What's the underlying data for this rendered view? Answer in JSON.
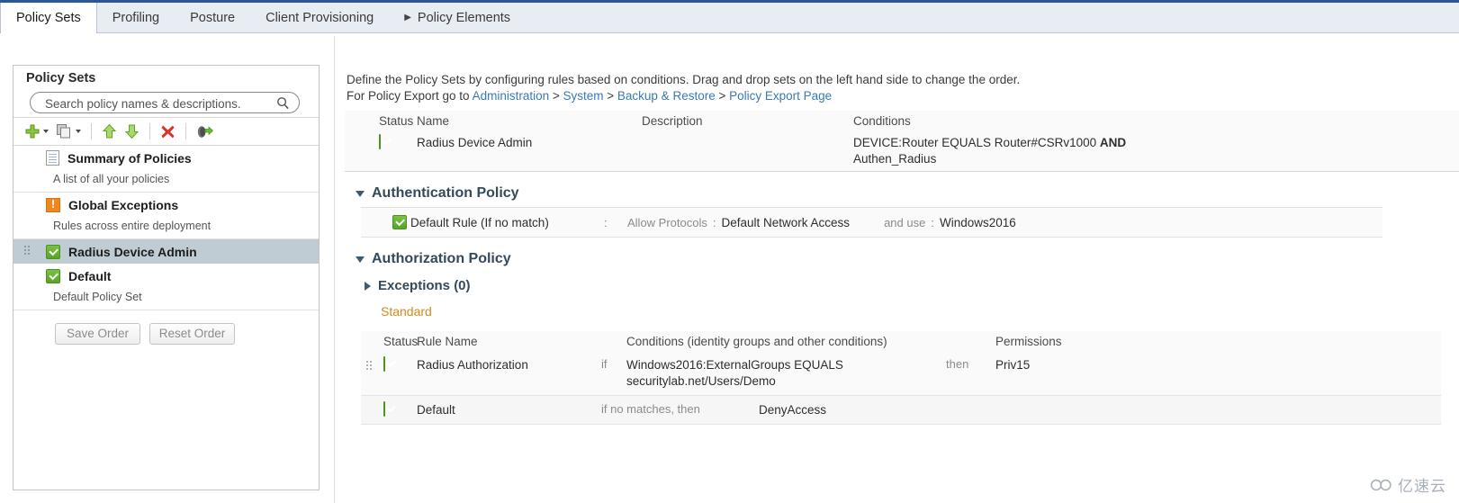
{
  "tabs": [
    {
      "label": "Policy Sets",
      "active": true,
      "arrow": false
    },
    {
      "label": "Profiling",
      "active": false,
      "arrow": false
    },
    {
      "label": "Posture",
      "active": false,
      "arrow": false
    },
    {
      "label": "Client Provisioning",
      "active": false,
      "arrow": false
    },
    {
      "label": "Policy Elements",
      "active": false,
      "arrow": true
    }
  ],
  "sidebar": {
    "title": "Policy Sets",
    "search_placeholder": "Search policy names & descriptions.",
    "search_value": "",
    "toolbar": [
      {
        "name": "add",
        "glyph": "+",
        "dropdown": true
      },
      {
        "name": "duplicate",
        "glyph": "copy",
        "dropdown": true
      },
      {
        "name": "move-up",
        "glyph": "up",
        "dropdown": false
      },
      {
        "name": "move-down",
        "glyph": "down",
        "dropdown": false
      },
      {
        "name": "delete",
        "glyph": "x",
        "dropdown": false
      },
      {
        "name": "export",
        "glyph": "export",
        "dropdown": false
      }
    ],
    "items": [
      {
        "label": "Summary of Policies",
        "sub": "A list of all your policies",
        "icon": "document",
        "selected": false,
        "grip": false
      },
      {
        "label": "Global Exceptions",
        "sub": "Rules across entire deployment",
        "icon": "warning",
        "selected": false,
        "grip": false
      },
      {
        "label": "Radius Device Admin",
        "sub": "",
        "icon": "check",
        "selected": true,
        "grip": true
      },
      {
        "label": "Default",
        "sub": "Default Policy Set",
        "icon": "check",
        "selected": false,
        "grip": false
      }
    ],
    "save_order_label": "Save Order",
    "reset_order_label": "Reset Order"
  },
  "main": {
    "intro_line1": "Define the Policy Sets by configuring rules based on conditions. Drag and drop sets on the left hand side to change the order.",
    "intro_line2_prefix": "For Policy Export go to ",
    "intro_breadcrumb": [
      {
        "text": "Administration",
        "link": true
      },
      {
        "text": " > ",
        "link": false
      },
      {
        "text": "System",
        "link": true
      },
      {
        "text": " > ",
        "link": false
      },
      {
        "text": "Backup & Restore",
        "link": true
      },
      {
        "text": " > ",
        "link": false
      },
      {
        "text": "Policy Export Page",
        "link": true
      }
    ],
    "policyset_table": {
      "headers": [
        "Status",
        "Name",
        "Description",
        "Conditions"
      ],
      "row": {
        "status": "enabled",
        "name": "Radius Device Admin",
        "description": "",
        "conditions_line1_normal": "DEVICE:Router EQUALS Router#CSRv1000 ",
        "conditions_line1_bold": "AND",
        "conditions_line2": "Authen_Radius"
      }
    },
    "authentication_policy": {
      "title": "Authentication Policy",
      "expanded": true,
      "rule": {
        "status": "enabled",
        "name": "Default Rule (If no match)",
        "colon1": ":",
        "allow_protocols_label": "Allow Protocols",
        "colon2": ":",
        "allow_protocols_value": "Default Network Access",
        "and_use_label": "and use",
        "colon3": ":",
        "and_use_value": "Windows2016"
      }
    },
    "authorization_policy": {
      "title": "Authorization Policy",
      "expanded": true,
      "exceptions_label": "Exceptions (0)",
      "exceptions_expanded": false,
      "standard_label": "Standard",
      "table": {
        "headers": [
          "Status",
          "Rule Name",
          "Conditions (identity groups and other conditions)",
          "Permissions"
        ],
        "rows": [
          {
            "status": "enabled",
            "rule_name": "Radius Authorization",
            "if_label": "if",
            "condition_line1": "Windows2016:ExternalGroups EQUALS",
            "condition_line2": "securitylab.net/Users/Demo",
            "then_label": "then",
            "permission": "Priv15",
            "grip": true,
            "default_row": false
          },
          {
            "status": "enabled",
            "rule_name": "Default",
            "if_label": "if no matches, then",
            "condition_line1": "",
            "condition_line2": "",
            "then_label": "",
            "permission": "DenyAccess",
            "grip": false,
            "default_row": true
          }
        ]
      }
    }
  },
  "watermark": {
    "text": "亿速云"
  },
  "colors": {
    "accent_blue": "#2b5797",
    "link_blue": "#3a7ab5",
    "status_green": "#57a526",
    "warning_orange": "#f0861d",
    "standard_orange": "#d38b1c",
    "selection_gray": "#c0ccd4"
  }
}
